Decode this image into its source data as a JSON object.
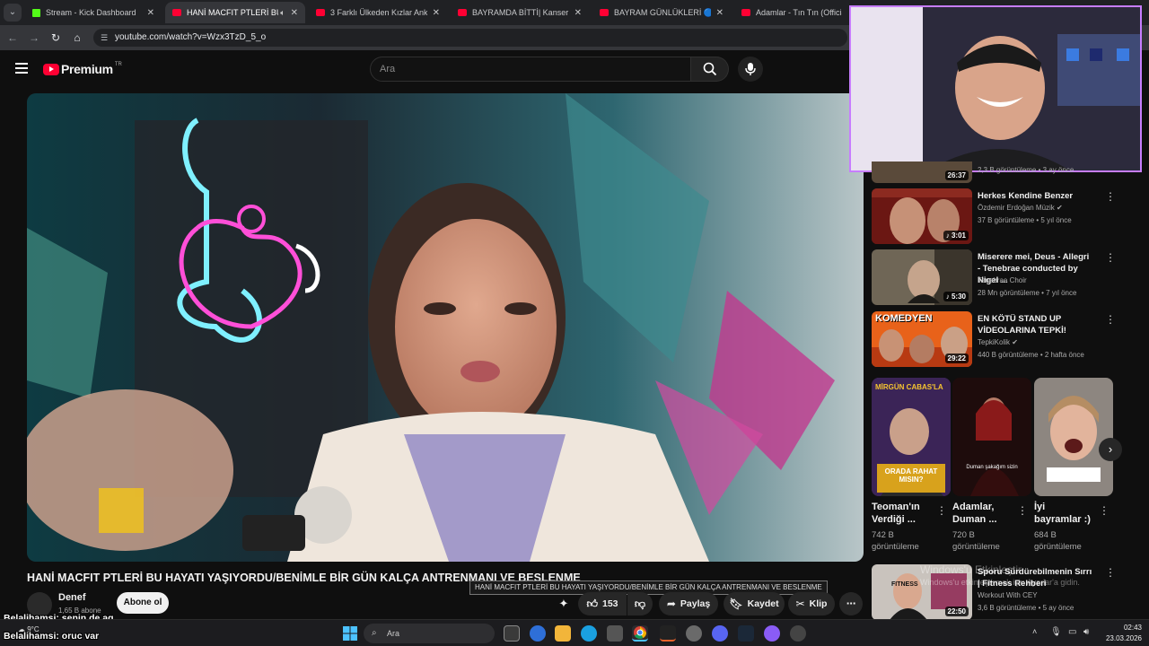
{
  "browser": {
    "tabs": [
      {
        "title": "Stream - Kick Dashboard",
        "active": false
      },
      {
        "title": "HANİ MACFIT PTLERİ BU Ha",
        "active": true
      },
      {
        "title": "3 Farklı Ülkeden Kızlar Ankara'",
        "active": false
      },
      {
        "title": "BAYRAMDA BİTTİ| Kanser oldu",
        "active": false
      },
      {
        "title": "BAYRAM GÜNLÜKLERİ 🔵 (go t",
        "active": false
      },
      {
        "title": "Adamlar - Tın Tın (Official Au",
        "active": false
      }
    ],
    "url": "youtube.com/watch?v=Wzx3TzD_5_o"
  },
  "youtube": {
    "logo_text": "Premium",
    "logo_sup": "TR",
    "search_placeholder": "Ara"
  },
  "video": {
    "title": "HANİ MACFIT PTLERİ BU HAYATI YAŞIYORDU/BENİMLE BİR GÜN KALÇA ANTRENMANI VE BESLENME",
    "tooltip": "HANİ MACFIT PTLERİ BU HAYATI YAŞIYORDU/BENİMLE BİR GÜN KALÇA ANTRENMANI VE BESLENME",
    "channel_name": "Denef",
    "channel_subs": "1,65 B abone",
    "subscribe_label": "Abone ol",
    "like_count": "153",
    "share_label": "Paylaş",
    "save_label": "Kaydet",
    "clip_label": "Klip"
  },
  "sidebar": {
    "partial_meta": "2,3 B görüntüleme • 3 ay önce",
    "partial_duration": "26:37",
    "videos": [
      {
        "title": "Herkes Kendine Benzer",
        "channel": "Özdemir Erdoğan Müzik",
        "meta": "37 B görüntüleme • 5 yıl önce",
        "duration": "3:01"
      },
      {
        "title": "Miserere mei, Deus - Allegri - Tenebrae conducted by Nigel ...",
        "channel": "Tenebrae Choir",
        "meta": "28 Mn görüntüleme • 7 yıl önce",
        "duration": "5:30"
      },
      {
        "title": "EN KÖTÜ STAND UP VİDEOLARINA TEPKİ!",
        "channel": "TepkiKolik",
        "meta": "440 B görüntüleme • 2 hafta önce",
        "duration": "29:22",
        "thumb_text": "KOMEDYEN"
      },
      {
        "title": "Sporu Sürdürebilmenin Sırrı | Fitness Rehberi",
        "channel": "Workout With CEY",
        "meta": "3,6 B görüntüleme • 5 ay önce",
        "duration": "22:50"
      }
    ],
    "shorts": [
      {
        "title": "Teoman'ın Verdiği ...",
        "views": "742 B",
        "views_label": "görüntüleme",
        "thumb_top": "MİRGÜN CABAS'LA",
        "thumb_bottom": "ORADA RAHAT MISIN?"
      },
      {
        "title": "Adamlar, Duman ...",
        "views": "720 B",
        "views_label": "görüntüleme",
        "thumb_caption": "Duman şakağım sizin"
      },
      {
        "title": "İyi bayramlar :)",
        "views": "684 B",
        "views_label": "görüntüleme"
      }
    ]
  },
  "overlay": {
    "watermark_line1": "Windows'u Etkinleştir",
    "watermark_line2": "Windows'u etkinleştirmek için Ayarlar'a gidin.",
    "chat": [
      {
        "name": "Belalihamsi",
        "msg": ": senin de aq"
      },
      {
        "name": "Belalihamsi",
        "msg": ": oruc var"
      }
    ]
  },
  "taskbar": {
    "search_label": "Ara",
    "weather": "9°C",
    "time": "02:43",
    "date": "23.03.2026"
  },
  "colors": {
    "yt_red": "#ff0033",
    "bg": "#0f0f0f",
    "cam_border": "#c77dff",
    "kick_green": "#53fc18"
  }
}
